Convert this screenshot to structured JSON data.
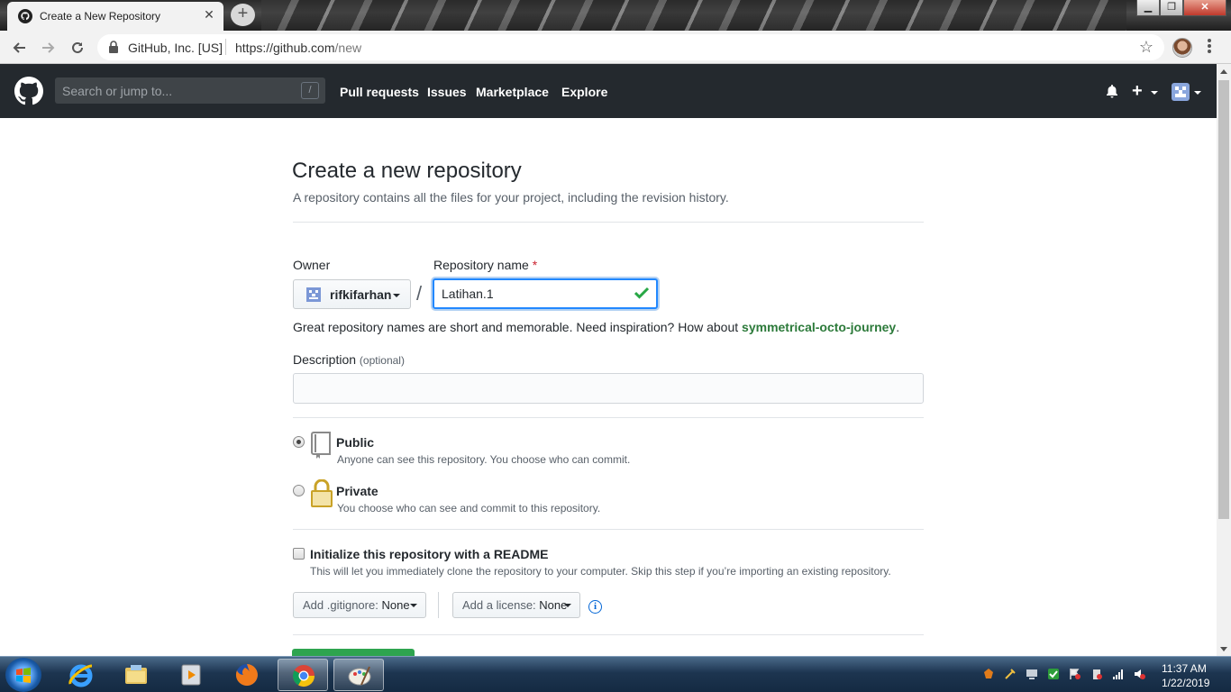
{
  "browser": {
    "tab_title": "Create a New Repository",
    "new_tab": "+",
    "close": "✕",
    "site_identity": "GitHub, Inc. [US]",
    "url_host": "https://github.com",
    "url_path": "/new"
  },
  "header": {
    "search_placeholder": "Search or jump to...",
    "search_shortcut": "/",
    "nav": [
      "Pull requests",
      "Issues",
      "Marketplace",
      "Explore"
    ],
    "plus": "+"
  },
  "form": {
    "title": "Create a new repository",
    "subtitle": "A repository contains all the files for your project, including the revision history.",
    "owner_label": "Owner",
    "owner_value": "rifkifarhan",
    "slash": "/",
    "repo_label": "Repository name",
    "required_mark": "*",
    "repo_value": "Latihan.1",
    "hint_prefix": "Great repository names are short and memorable. Need inspiration? How about ",
    "hint_suggestion": "symmetrical-octo-journey",
    "hint_suffix": ".",
    "description_label": "Description",
    "description_optional": "(optional)",
    "description_value": "",
    "visibility": [
      {
        "title": "Public",
        "note": "Anyone can see this repository. You choose who can commit.",
        "selected": true
      },
      {
        "title": "Private",
        "note": "You choose who can see and commit to this repository.",
        "selected": false
      }
    ],
    "readme_label": "Initialize this repository with a README",
    "readme_note": "This will let you immediately clone the repository to your computer. Skip this step if you’re importing an existing repository.",
    "readme_checked": false,
    "gitignore_label": "Add .gitignore:",
    "gitignore_value": "None",
    "license_label": "Add a license:",
    "license_value": "None",
    "info": "i"
  },
  "taskbar": {
    "time": "11:37 AM",
    "date": "1/22/2019"
  },
  "colors": {
    "header_bg": "#24292e",
    "focus_blue": "#2188ff",
    "create_green": "#2ea44f",
    "check_green": "#28a745"
  }
}
